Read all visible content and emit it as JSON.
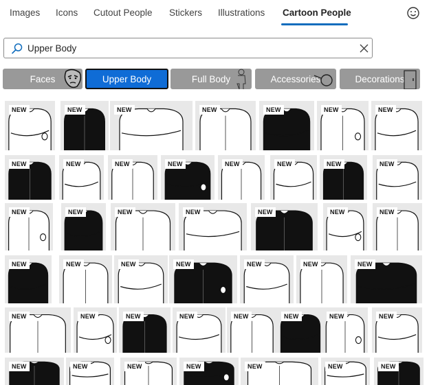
{
  "tabs": [
    {
      "label": "Images"
    },
    {
      "label": "Icons"
    },
    {
      "label": "Cutout People"
    },
    {
      "label": "Stickers"
    },
    {
      "label": "Illustrations"
    },
    {
      "label": "Cartoon People"
    }
  ],
  "active_tab": "Cartoon People",
  "search": {
    "value": "Upper Body",
    "icon": "search-icon",
    "clear_icon": "close-icon"
  },
  "categories": [
    {
      "label": "Faces",
      "selected": false
    },
    {
      "label": "Upper Body",
      "selected": true
    },
    {
      "label": "Full Body",
      "selected": false
    },
    {
      "label": "Accessories",
      "selected": false
    },
    {
      "label": "Decorations",
      "selected": false
    }
  ],
  "badge_text": "NEW",
  "colors": {
    "accent": "#0f6cbd",
    "category_bg": "#999999",
    "category_selected": "#0f6cd6",
    "tile_bg": "#e8e8e8"
  }
}
